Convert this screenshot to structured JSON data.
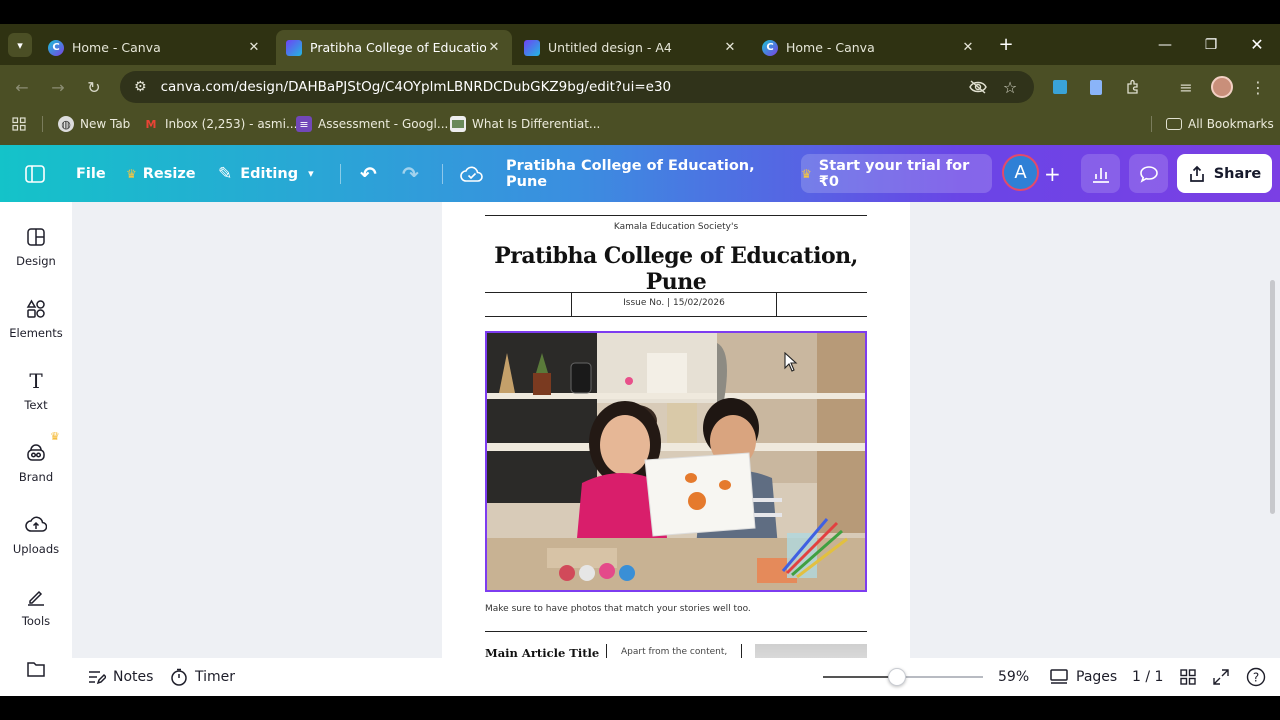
{
  "browser": {
    "tabs": [
      {
        "title": "Home - Canva",
        "icon": "canva-favicon",
        "active": false
      },
      {
        "title": "Pratibha College of Education, Pune - Canva",
        "icon": "canva-doc-favicon",
        "active": true
      },
      {
        "title": "Untitled design - A4",
        "icon": "canva-doc-favicon",
        "active": false
      },
      {
        "title": "Home - Canva",
        "icon": "canva-favicon",
        "active": false
      }
    ],
    "url": "canva.com/design/DAHBaPJStOg/C4OYplmLBNRDCDubGKZ9bg/edit?ui=e30",
    "bookmarks": [
      {
        "label": "New Tab",
        "icon": "globe-icon"
      },
      {
        "label": "Inbox (2,253) - asmi...",
        "icon": "gmail-icon"
      },
      {
        "label": "Assessment - Googl...",
        "icon": "forms-icon"
      },
      {
        "label": "What Is Differentiat...",
        "icon": "image-icon"
      }
    ],
    "all_bookmarks": "All Bookmarks"
  },
  "header": {
    "file": "File",
    "resize": "Resize",
    "editing": "Editing",
    "doc_title": "Pratibha College of Education, Pune",
    "trial": "Start your trial for ₹0",
    "avatar_letter": "A",
    "share": "Share"
  },
  "sidebar": {
    "items": [
      {
        "label": "Design",
        "icon": "design-icon"
      },
      {
        "label": "Elements",
        "icon": "elements-icon"
      },
      {
        "label": "Text",
        "icon": "text-icon"
      },
      {
        "label": "Brand",
        "icon": "brand-icon"
      },
      {
        "label": "Uploads",
        "icon": "uploads-icon"
      },
      {
        "label": "Tools",
        "icon": "tools-icon"
      },
      {
        "label": "",
        "icon": "projects-icon"
      }
    ]
  },
  "page": {
    "society": "Kamala Education Society's",
    "college": "Pratibha College of Education, Pune",
    "issue": "Issue No.  |  15/02/2026",
    "caption": "Make sure to have photos that match your stories well too.",
    "article_title": "Main Article Title",
    "article_text": "Apart  from  the  content,"
  },
  "bottom": {
    "notes": "Notes",
    "timer": "Timer",
    "zoom": "59%",
    "zoom_fraction": 0.46,
    "pages": "Pages",
    "page_count": "1 / 1"
  },
  "colors": {
    "accent_purple": "#7d3cf0",
    "header_start": "#14c3c9",
    "header_end": "#7b3fe4",
    "browser_dark": "#2f3212",
    "browser_mid": "#4b4f25"
  }
}
